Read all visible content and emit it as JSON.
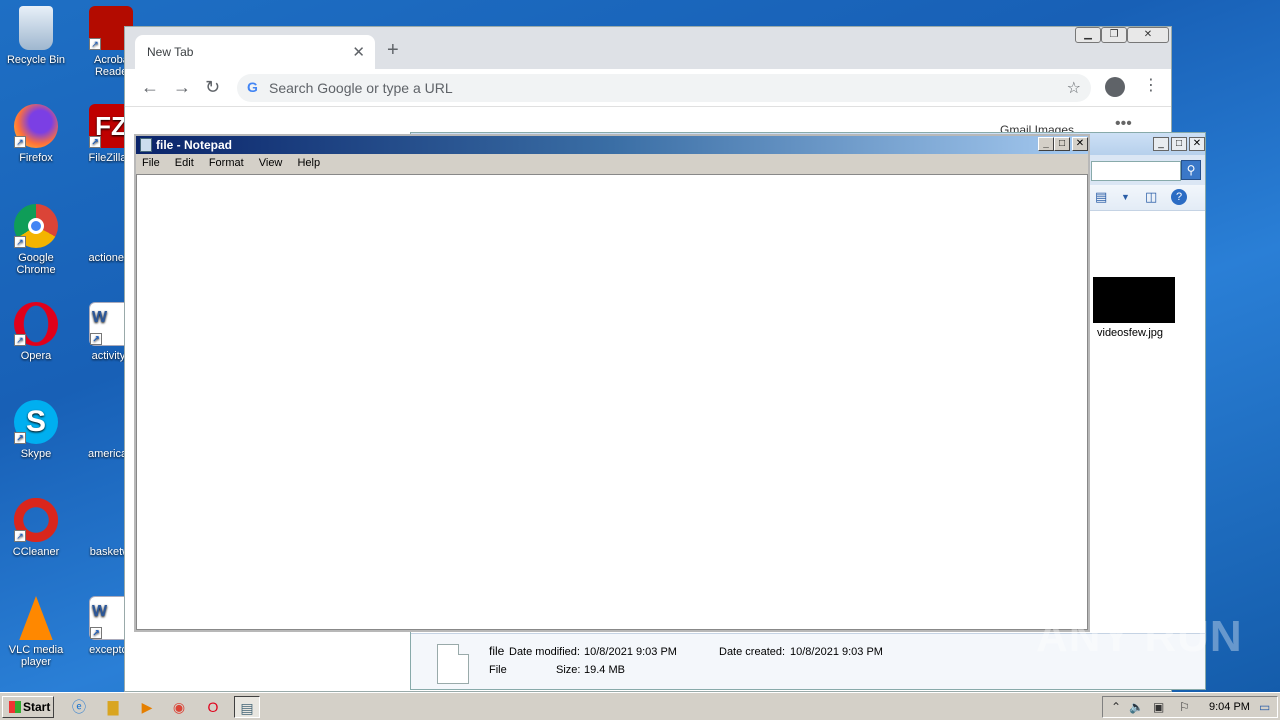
{
  "desktop": {
    "icons_left": [
      {
        "label": "Recycle Bin",
        "icon": "recycle-bin-icon"
      },
      {
        "label": "Firefox",
        "icon": "firefox-icon"
      },
      {
        "label": "Google Chrome",
        "icon": "chrome-icon"
      },
      {
        "label": "Opera",
        "icon": "opera-icon"
      },
      {
        "label": "Skype",
        "icon": "skype-icon"
      },
      {
        "label": "CCleaner",
        "icon": "ccleaner-icon"
      },
      {
        "label": "VLC media player",
        "icon": "vlc-icon"
      }
    ],
    "icons_right": [
      {
        "label": "Acrobat Reader",
        "icon": "acrobat-icon"
      },
      {
        "label": "FileZilla C",
        "icon": "filezilla-icon"
      },
      {
        "label": "actionerro",
        "icon": "blank-file-icon"
      },
      {
        "label": "activityfa",
        "icon": "word-doc-icon"
      },
      {
        "label": "americand",
        "icon": "blank-file-icon"
      },
      {
        "label": "basketwo",
        "icon": "blank-file-icon"
      },
      {
        "label": "exceptcor",
        "icon": "word-doc-icon"
      }
    ]
  },
  "chrome": {
    "tab_title": "New Tab",
    "omnibox_placeholder": "Search Google or type a URL",
    "content_fragment": "Gmail   Images"
  },
  "explorer": {
    "thumbnail_label": "videosfew.jpg",
    "details": {
      "name": "file",
      "type": "File",
      "date_modified_label": "Date modified:",
      "date_modified": "10/8/2021 9:03 PM",
      "date_created_label": "Date created:",
      "date_created": "10/8/2021 9:03 PM",
      "size_label": "Size:",
      "size": "19.4 MB"
    }
  },
  "notepad": {
    "title": "file - Notepad",
    "menu": [
      "File",
      "Edit",
      "Format",
      "View",
      "Help"
    ],
    "content": ""
  },
  "watermark": "ANY RUN",
  "taskbar": {
    "start_label": "Start",
    "clock": "9:04 PM"
  }
}
